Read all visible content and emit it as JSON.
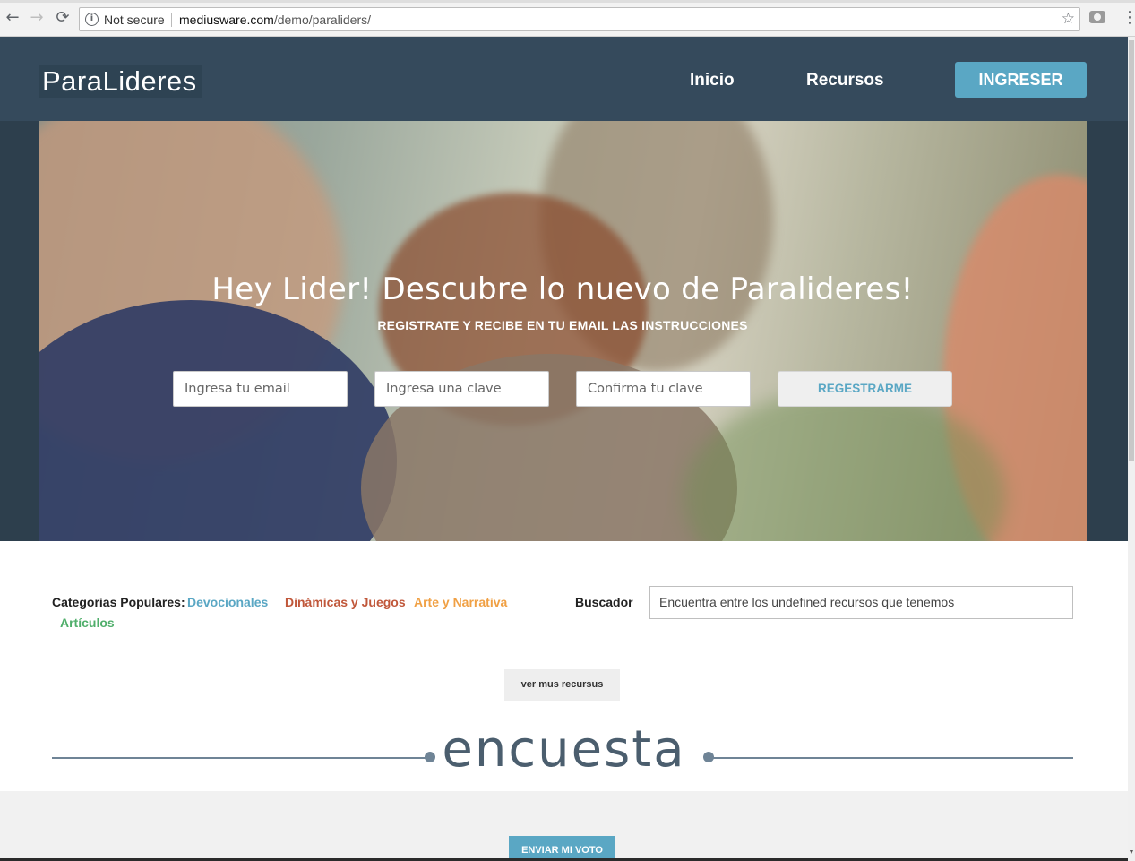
{
  "browser": {
    "security_label": "Not secure",
    "url_domain": "mediusware.com",
    "url_path": "/demo/paraliders/"
  },
  "header": {
    "logo_text": "ParaLideres",
    "nav": [
      "Inicio",
      "Recursos"
    ],
    "login_button": "INGRESER"
  },
  "hero": {
    "title": "Hey Lider! Descubre lo nuevo de Paralideres!",
    "subtitle": "REGISTRATE Y RECIBE EN TU EMAIL LAS INSTRUCCIONES",
    "email_placeholder": "Ingresa tu email",
    "password_placeholder": "Ingresa una clave",
    "confirm_placeholder": "Confirma tu clave",
    "register_button": "REGESTRARME"
  },
  "categories": {
    "label": "Categorias Populares:",
    "items": [
      {
        "label": "Devocionales",
        "color": "#5aa7c4"
      },
      {
        "label": "Dinámicas y Juegos",
        "color": "#c0573a"
      },
      {
        "label": "Arte y Narrativa",
        "color": "#f0a044"
      },
      {
        "label": "Artículos",
        "color": "#4fae6a"
      }
    ]
  },
  "search": {
    "label": "Buscador",
    "placeholder": "Encuentra entre los undefined recursos que tenemos"
  },
  "more_button": "ver mus recursus",
  "survey": {
    "title": "encuesta",
    "vote_button": "ENVIAR MI VOTO"
  },
  "colors": {
    "header_bg": "#354a5c",
    "accent": "#5aa7c4"
  }
}
